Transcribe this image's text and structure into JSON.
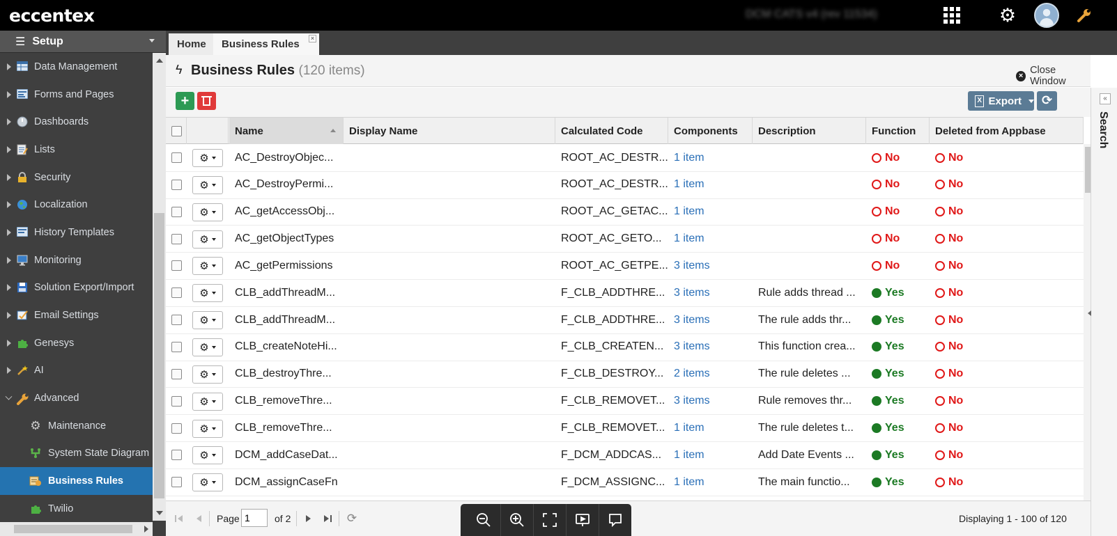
{
  "app": {
    "logo": "eccentex",
    "user_name": "DCM CATS v4 (rev 11534)"
  },
  "topbar": {
    "apps_icon": "grid-icon",
    "settings_icon": "gear-icon",
    "tools_icon": "wrench-icon"
  },
  "sidebar": {
    "header": "Setup",
    "items": [
      {
        "label": "Data Management",
        "icon": "table-icon"
      },
      {
        "label": "Forms and Pages",
        "icon": "form-icon"
      },
      {
        "label": "Dashboards",
        "icon": "dashboard-icon"
      },
      {
        "label": "Lists",
        "icon": "list-icon"
      },
      {
        "label": "Security",
        "icon": "lock-icon"
      },
      {
        "label": "Localization",
        "icon": "globe-icon"
      },
      {
        "label": "History Templates",
        "icon": "history-icon"
      },
      {
        "label": "Monitoring",
        "icon": "monitor-icon"
      },
      {
        "label": "Solution Export/Import",
        "icon": "floppy-icon"
      },
      {
        "label": "Email Settings",
        "icon": "email-icon"
      },
      {
        "label": "Genesys",
        "icon": "puzzle-icon"
      },
      {
        "label": "AI",
        "icon": "wand-icon"
      },
      {
        "label": "Advanced",
        "icon": "wrench-icon"
      },
      {
        "label": "Maintenance",
        "icon": "gear-icon"
      },
      {
        "label": "System State Diagram",
        "icon": "diagram-icon"
      },
      {
        "label": "Business Rules",
        "icon": "rules-icon"
      },
      {
        "label": "Twilio",
        "icon": "puzzle-icon"
      }
    ]
  },
  "tabs": {
    "home": "Home",
    "business_rules": "Business Rules"
  },
  "panel": {
    "title": "Business Rules",
    "count": "(120 items)",
    "close_window": "Close Window"
  },
  "toolbar": {
    "export": "Export"
  },
  "grid": {
    "columns": [
      "Name",
      "Display Name",
      "Calculated Code",
      "Components",
      "Description",
      "Function",
      "Deleted from Appbase"
    ],
    "rows": [
      {
        "name": "AC_DestroyObjec...",
        "display": "",
        "code": "ROOT_AC_DESTR...",
        "components": "1 item",
        "description": "",
        "function": "No",
        "deleted": "No"
      },
      {
        "name": "AC_DestroyPermi...",
        "display": "",
        "code": "ROOT_AC_DESTR...",
        "components": "1 item",
        "description": "",
        "function": "No",
        "deleted": "No"
      },
      {
        "name": "AC_getAccessObj...",
        "display": "",
        "code": "ROOT_AC_GETAC...",
        "components": "1 item",
        "description": "",
        "function": "No",
        "deleted": "No"
      },
      {
        "name": "AC_getObjectTypes",
        "display": "",
        "code": "ROOT_AC_GETO...",
        "components": "1 item",
        "description": "",
        "function": "No",
        "deleted": "No"
      },
      {
        "name": "AC_getPermissions",
        "display": "",
        "code": "ROOT_AC_GETPE...",
        "components": "3 items",
        "description": "",
        "function": "No",
        "deleted": "No"
      },
      {
        "name": "CLB_addThreadM...",
        "display": "",
        "code": "F_CLB_ADDTHRE...",
        "components": "3 items",
        "description": "Rule adds thread ...",
        "function": "Yes",
        "deleted": "No"
      },
      {
        "name": "CLB_addThreadM...",
        "display": "",
        "code": "F_CLB_ADDTHRE...",
        "components": "3 items",
        "description": "The rule adds thr...",
        "function": "Yes",
        "deleted": "No"
      },
      {
        "name": "CLB_createNoteHi...",
        "display": "",
        "code": "F_CLB_CREATEN...",
        "components": "3 items",
        "description": "This function crea...",
        "function": "Yes",
        "deleted": "No"
      },
      {
        "name": "CLB_destroyThre...",
        "display": "",
        "code": "F_CLB_DESTROY...",
        "components": "2 items",
        "description": "The rule deletes ...",
        "function": "Yes",
        "deleted": "No"
      },
      {
        "name": "CLB_removeThre...",
        "display": "",
        "code": "F_CLB_REMOVET...",
        "components": "3 items",
        "description": "Rule removes thr...",
        "function": "Yes",
        "deleted": "No"
      },
      {
        "name": "CLB_removeThre...",
        "display": "",
        "code": "F_CLB_REMOVET...",
        "components": "1 item",
        "description": "The rule deletes t...",
        "function": "Yes",
        "deleted": "No"
      },
      {
        "name": "DCM_addCaseDat...",
        "display": "",
        "code": "F_DCM_ADDCAS...",
        "components": "1 item",
        "description": "Add Date Events ...",
        "function": "Yes",
        "deleted": "No"
      },
      {
        "name": "DCM_assignCaseFn",
        "display": "",
        "code": "F_DCM_ASSIGNC...",
        "components": "1 item",
        "description": "The main functio...",
        "function": "Yes",
        "deleted": "No"
      }
    ]
  },
  "pager": {
    "page_label": "Page",
    "page_value": "1",
    "of": "of 2",
    "display": "Displaying 1 - 100 of 120"
  },
  "search_strip": {
    "label": "Search"
  },
  "colors": {
    "accent": "#2473b0",
    "add": "#2d9a54",
    "delete": "#e03a3a",
    "yes": "#1c7a24",
    "no": "#e01818",
    "link": "#2a6fb7"
  }
}
